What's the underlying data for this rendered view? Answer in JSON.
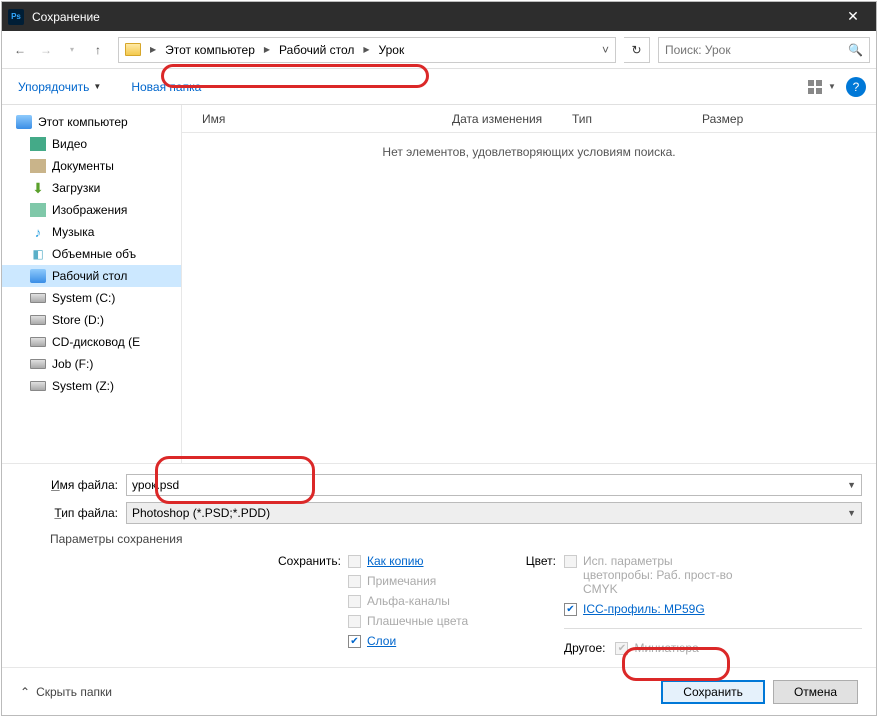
{
  "title": "Сохранение",
  "breadcrumb": {
    "items": [
      "Этот компьютер",
      "Рабочий стол",
      "Урок"
    ]
  },
  "search": {
    "placeholder": "Поиск: Урок"
  },
  "toolbar": {
    "organize": "Упорядочить",
    "newfolder": "Новая папка"
  },
  "columns": {
    "name": "Имя",
    "date": "Дата изменения",
    "type": "Тип",
    "size": "Размер"
  },
  "empty": "Нет элементов, удовлетворяющих условиям поиска.",
  "tree": {
    "root": "Этот компьютер",
    "items": [
      {
        "key": "video",
        "label": "Видео"
      },
      {
        "key": "docs",
        "label": "Документы"
      },
      {
        "key": "downloads",
        "label": "Загрузки"
      },
      {
        "key": "pictures",
        "label": "Изображения"
      },
      {
        "key": "music",
        "label": "Музыка"
      },
      {
        "key": "volumes",
        "label": "Объемные объ"
      },
      {
        "key": "desktop",
        "label": "Рабочий стол"
      },
      {
        "key": "c",
        "label": "System (C:)"
      },
      {
        "key": "d",
        "label": "Store (D:)"
      },
      {
        "key": "e",
        "label": "CD-дисковод (E"
      },
      {
        "key": "f",
        "label": "Job (F:)"
      },
      {
        "key": "z",
        "label": "System (Z:)"
      }
    ]
  },
  "form": {
    "name_label_pre": "И",
    "name_label": "мя файла:",
    "type_label_pre": "Т",
    "type_label": "ип файла:",
    "name_value": "урок.psd",
    "type_value": "Photoshop (*.PSD;*.PDD)"
  },
  "optsTitle": "Параметры сохранения",
  "save_opts": {
    "save_label": "Сохранить:",
    "as_copy": "Как копию",
    "notes": "Примечания",
    "alpha": "Альфа-каналы",
    "spot": "Плашечные цвета",
    "layers": "Слои",
    "color_label": "Цвет:",
    "proof": "Исп. параметры цветопробы:  Раб. прост-во CMYK",
    "icc": "ICC-профиль: MP59G",
    "other_label": "Другое:",
    "thumb": "Миниатюра"
  },
  "footer": {
    "hide": "Скрыть папки",
    "save": "Сохранить",
    "cancel": "Отмена"
  }
}
